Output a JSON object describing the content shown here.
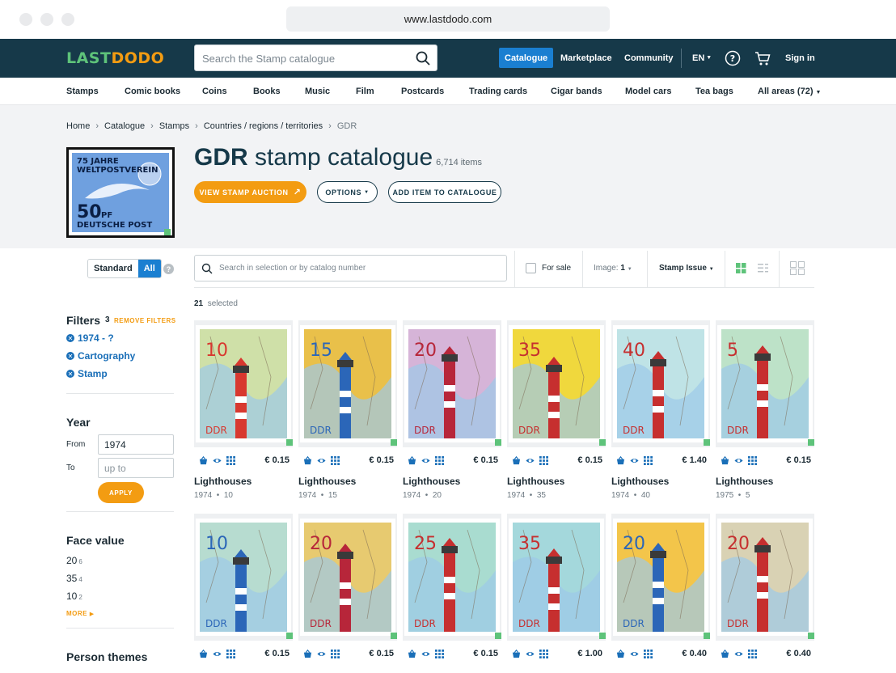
{
  "browser": {
    "url": "www.lastdodo.com"
  },
  "header": {
    "logo_left": "LAST",
    "logo_right": "DODO",
    "search_placeholder": "Search the Stamp catalogue",
    "nav": [
      "Catalogue",
      "Marketplace",
      "Community"
    ],
    "language": "EN",
    "signin": "Sign in"
  },
  "categories": [
    "Stamps",
    "Comic books",
    "Coins",
    "Books",
    "Music",
    "Film",
    "Postcards",
    "Trading cards",
    "Cigar bands",
    "Model cars",
    "Tea bags",
    "All areas (72)"
  ],
  "breadcrumb": [
    "Home",
    "Catalogue",
    "Stamps",
    "Countries / regions / territories",
    "GDR"
  ],
  "hero": {
    "title_bold": "GDR",
    "title_rest": "stamp catalogue",
    "count": "6,714 items",
    "stamp_text": [
      "75 JAHRE",
      "WELTPOSTVEREIN",
      "50",
      "PF",
      "DEUTSCHE POST"
    ],
    "btn_auction": "VIEW STAMP AUCTION",
    "btn_options": "OPTIONS",
    "btn_add": "ADD ITEM TO CATALOGUE"
  },
  "sidebar": {
    "mode_standard": "Standard",
    "mode_all": "All",
    "help": "?",
    "filters_title": "Filters",
    "filters_count": "3",
    "remove_filters": "REMOVE FILTERS",
    "active_filters": [
      "1974 - ?",
      "Cartography",
      "Stamp"
    ],
    "year_title": "Year",
    "from_label": "From",
    "from_value": "1974",
    "to_label": "To",
    "to_placeholder": "up to",
    "apply": "APPLY",
    "face_title": "Face value",
    "face_values": [
      {
        "v": "20",
        "c": "6"
      },
      {
        "v": "35",
        "c": "4"
      },
      {
        "v": "10",
        "c": "2"
      }
    ],
    "more": "MORE",
    "person_title": "Person themes"
  },
  "toolbar": {
    "search_placeholder": "Search in selection or by catalog number",
    "for_sale": "For sale",
    "image_label": "Image:",
    "image_value": "1",
    "sort": "Stamp Issue",
    "selected_count": "21",
    "selected_label": "selected"
  },
  "items": [
    {
      "title": "Lighthouses",
      "year": "1974",
      "value": "10",
      "price": "€ 0.15",
      "num": "10",
      "accent": "#d8382f",
      "bg": "#cfe0a8"
    },
    {
      "title": "Lighthouses",
      "year": "1974",
      "value": "15",
      "price": "€ 0.15",
      "num": "15",
      "accent": "#2b66b8",
      "bg": "#e9c04a"
    },
    {
      "title": "Lighthouses",
      "year": "1974",
      "value": "20",
      "price": "€ 0.15",
      "num": "20",
      "accent": "#b7263a",
      "bg": "#d6b4d8"
    },
    {
      "title": "Lighthouses",
      "year": "1974",
      "value": "35",
      "price": "€ 0.15",
      "num": "35",
      "accent": "#c62f2f",
      "bg": "#f0d83d"
    },
    {
      "title": "Lighthouses",
      "year": "1974",
      "value": "40",
      "price": "€ 1.40",
      "num": "40",
      "accent": "#c62f2f",
      "bg": "#bfe3e6"
    },
    {
      "title": "Lighthouses",
      "year": "1975",
      "value": "5",
      "price": "€ 0.15",
      "num": "5",
      "accent": "#c62f2f",
      "bg": "#bde2c8"
    },
    {
      "title": "",
      "year": "",
      "value": "",
      "price": "€ 0.15",
      "num": "10",
      "accent": "#2b66b8",
      "bg": "#b7dcd0"
    },
    {
      "title": "",
      "year": "",
      "value": "",
      "price": "€ 0.15",
      "num": "20",
      "accent": "#b7263a",
      "bg": "#e7ca70"
    },
    {
      "title": "",
      "year": "",
      "value": "",
      "price": "€ 0.15",
      "num": "25",
      "accent": "#c62f2f",
      "bg": "#a9dcd0"
    },
    {
      "title": "",
      "year": "",
      "value": "",
      "price": "€ 1.00",
      "num": "35",
      "accent": "#c62f2f",
      "bg": "#a4d8dc"
    },
    {
      "title": "",
      "year": "",
      "value": "",
      "price": "€ 0.40",
      "num": "20",
      "accent": "#2b66b8",
      "bg": "#f3c54a"
    },
    {
      "title": "",
      "year": "",
      "value": "",
      "price": "€ 0.40",
      "num": "20",
      "accent": "#c62f2f",
      "bg": "#d9d2b4"
    }
  ],
  "stamp_country": "DDR",
  "colors": {
    "navy": "#163949",
    "blue": "#1a7fd1",
    "orange": "#f39c12",
    "green": "#5ec37a"
  }
}
